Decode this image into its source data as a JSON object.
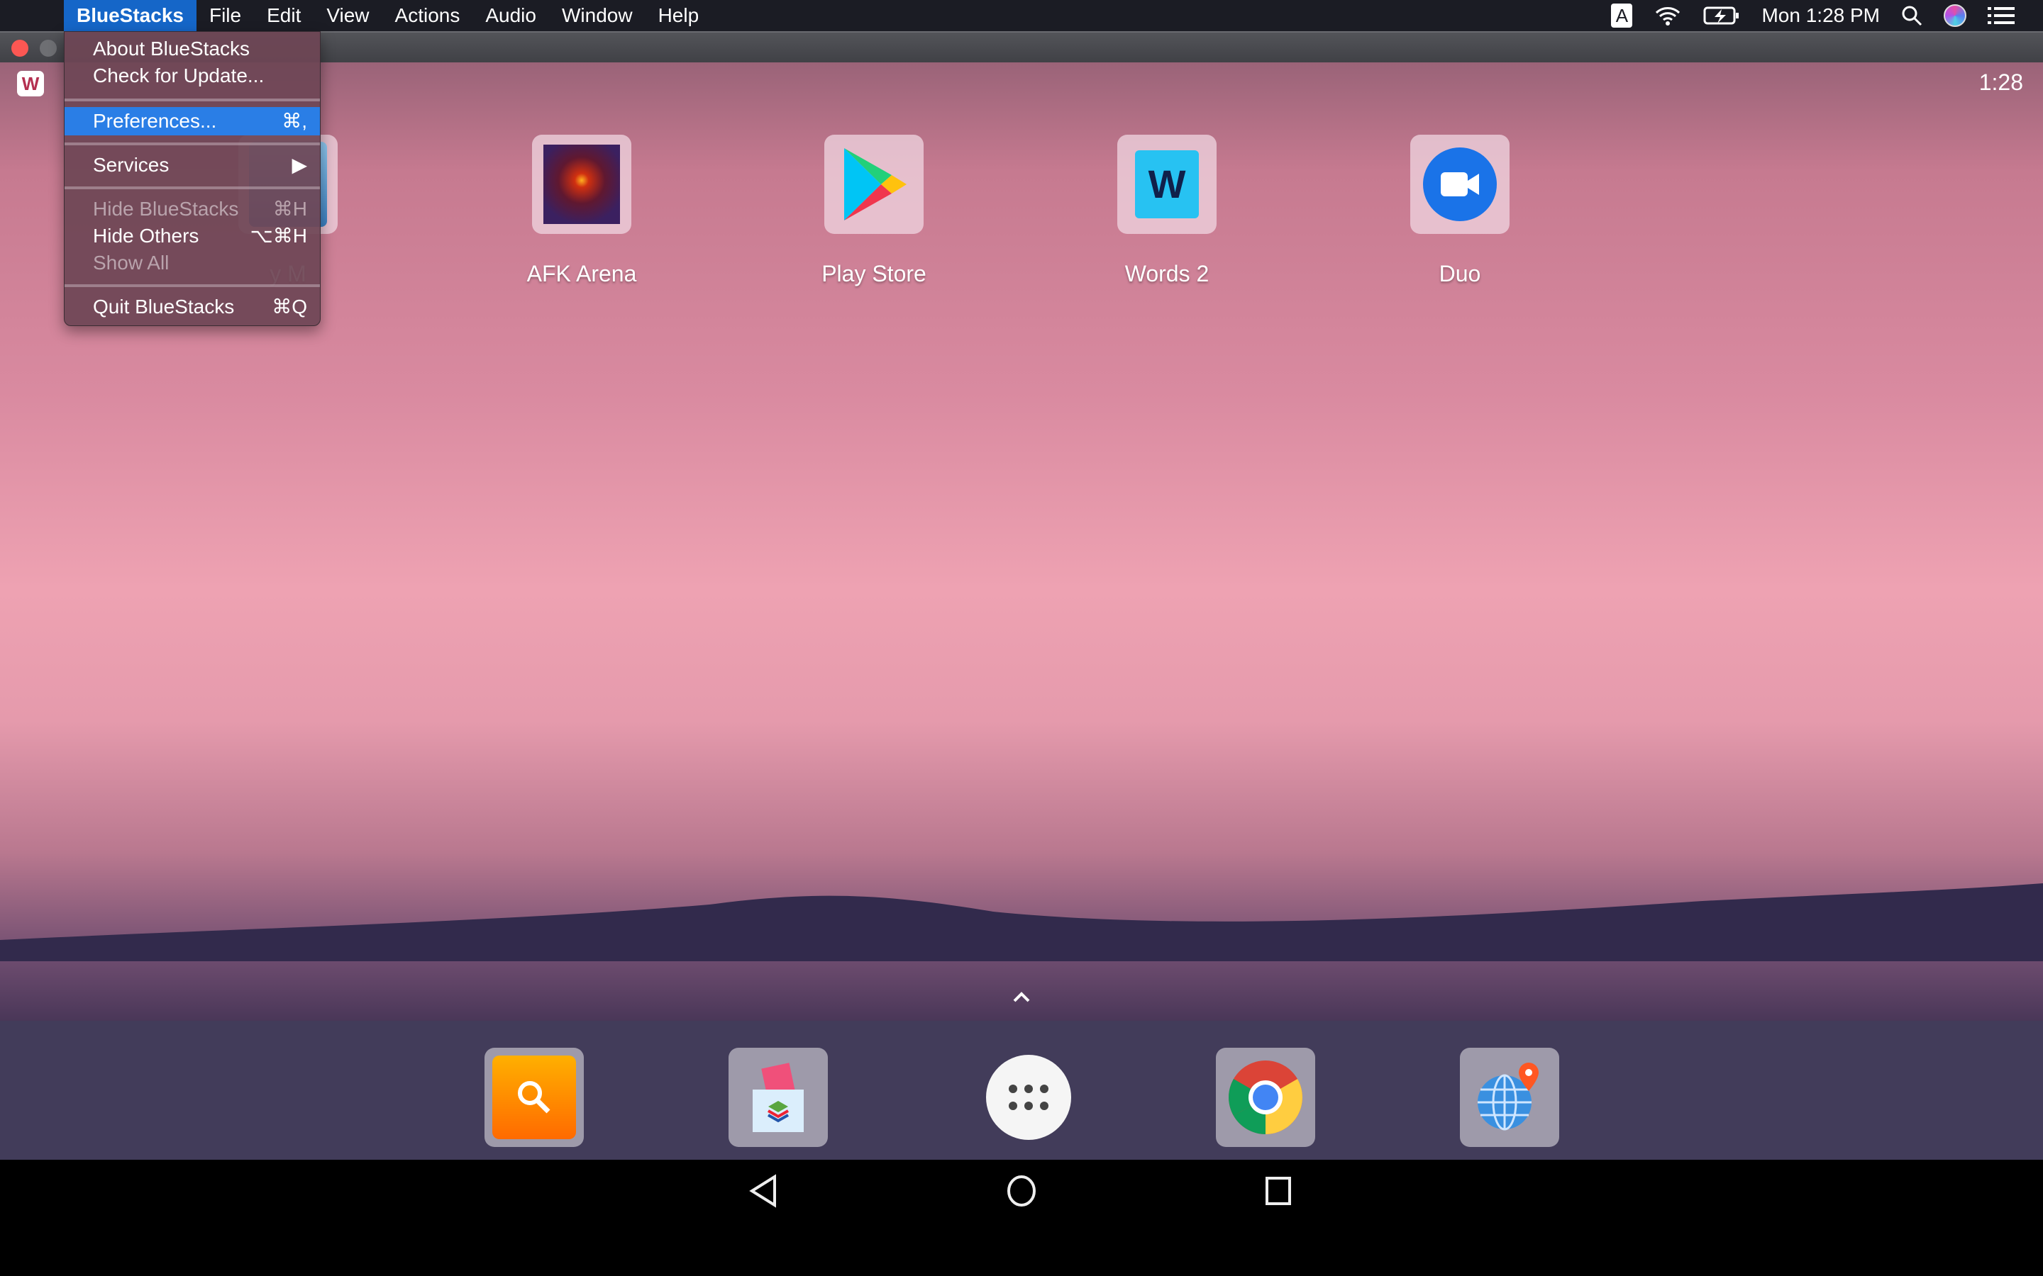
{
  "menubar": {
    "apple": "",
    "items": [
      "BlueStacks",
      "File",
      "Edit",
      "View",
      "Actions",
      "Audio",
      "Window",
      "Help"
    ],
    "input_source": "A",
    "clock": "Mon 1:28 PM"
  },
  "app_menu": {
    "items": [
      {
        "label": "About BlueStacks",
        "shortcut": "",
        "disabled": false
      },
      {
        "label": "Check for Update...",
        "shortcut": "",
        "disabled": false
      },
      {
        "label": "Preferences...",
        "shortcut": "⌘,",
        "disabled": false,
        "highlighted": true
      },
      {
        "label": "Services",
        "shortcut": "▶",
        "disabled": false
      },
      {
        "label": "Hide BlueStacks",
        "shortcut": "⌘H",
        "disabled": true
      },
      {
        "label": "Hide Others",
        "shortcut": "⌥⌘H",
        "disabled": false
      },
      {
        "label": "Show All",
        "shortcut": "",
        "disabled": true
      },
      {
        "label": "Quit BlueStacks",
        "shortcut": "⌘Q",
        "disabled": false
      }
    ]
  },
  "android": {
    "status_clock": "1:28",
    "notification_badge": "W",
    "apps": [
      {
        "label": "y M",
        "icon": "game-icon"
      },
      {
        "label": "AFK Arena",
        "icon": "afk-arena-icon"
      },
      {
        "label": "Play Store",
        "icon": "play-store-icon"
      },
      {
        "label": "Words 2",
        "icon": "words-icon",
        "glyph": "W"
      },
      {
        "label": "Duo",
        "icon": "duo-icon"
      }
    ],
    "dock": [
      {
        "name": "search-app",
        "icon": "search-icon"
      },
      {
        "name": "media-manager",
        "icon": "media-manager-icon"
      },
      {
        "name": "all-apps",
        "icon": "app-drawer-icon"
      },
      {
        "name": "chrome",
        "icon": "chrome-icon"
      },
      {
        "name": "location-app",
        "icon": "globe-pin-icon"
      }
    ],
    "nav": [
      "back",
      "home",
      "recents"
    ]
  },
  "colors": {
    "menubar_bg": "#1b1c24",
    "menu_highlight": "#2a7ee6",
    "active_menu": "#1566c8"
  }
}
